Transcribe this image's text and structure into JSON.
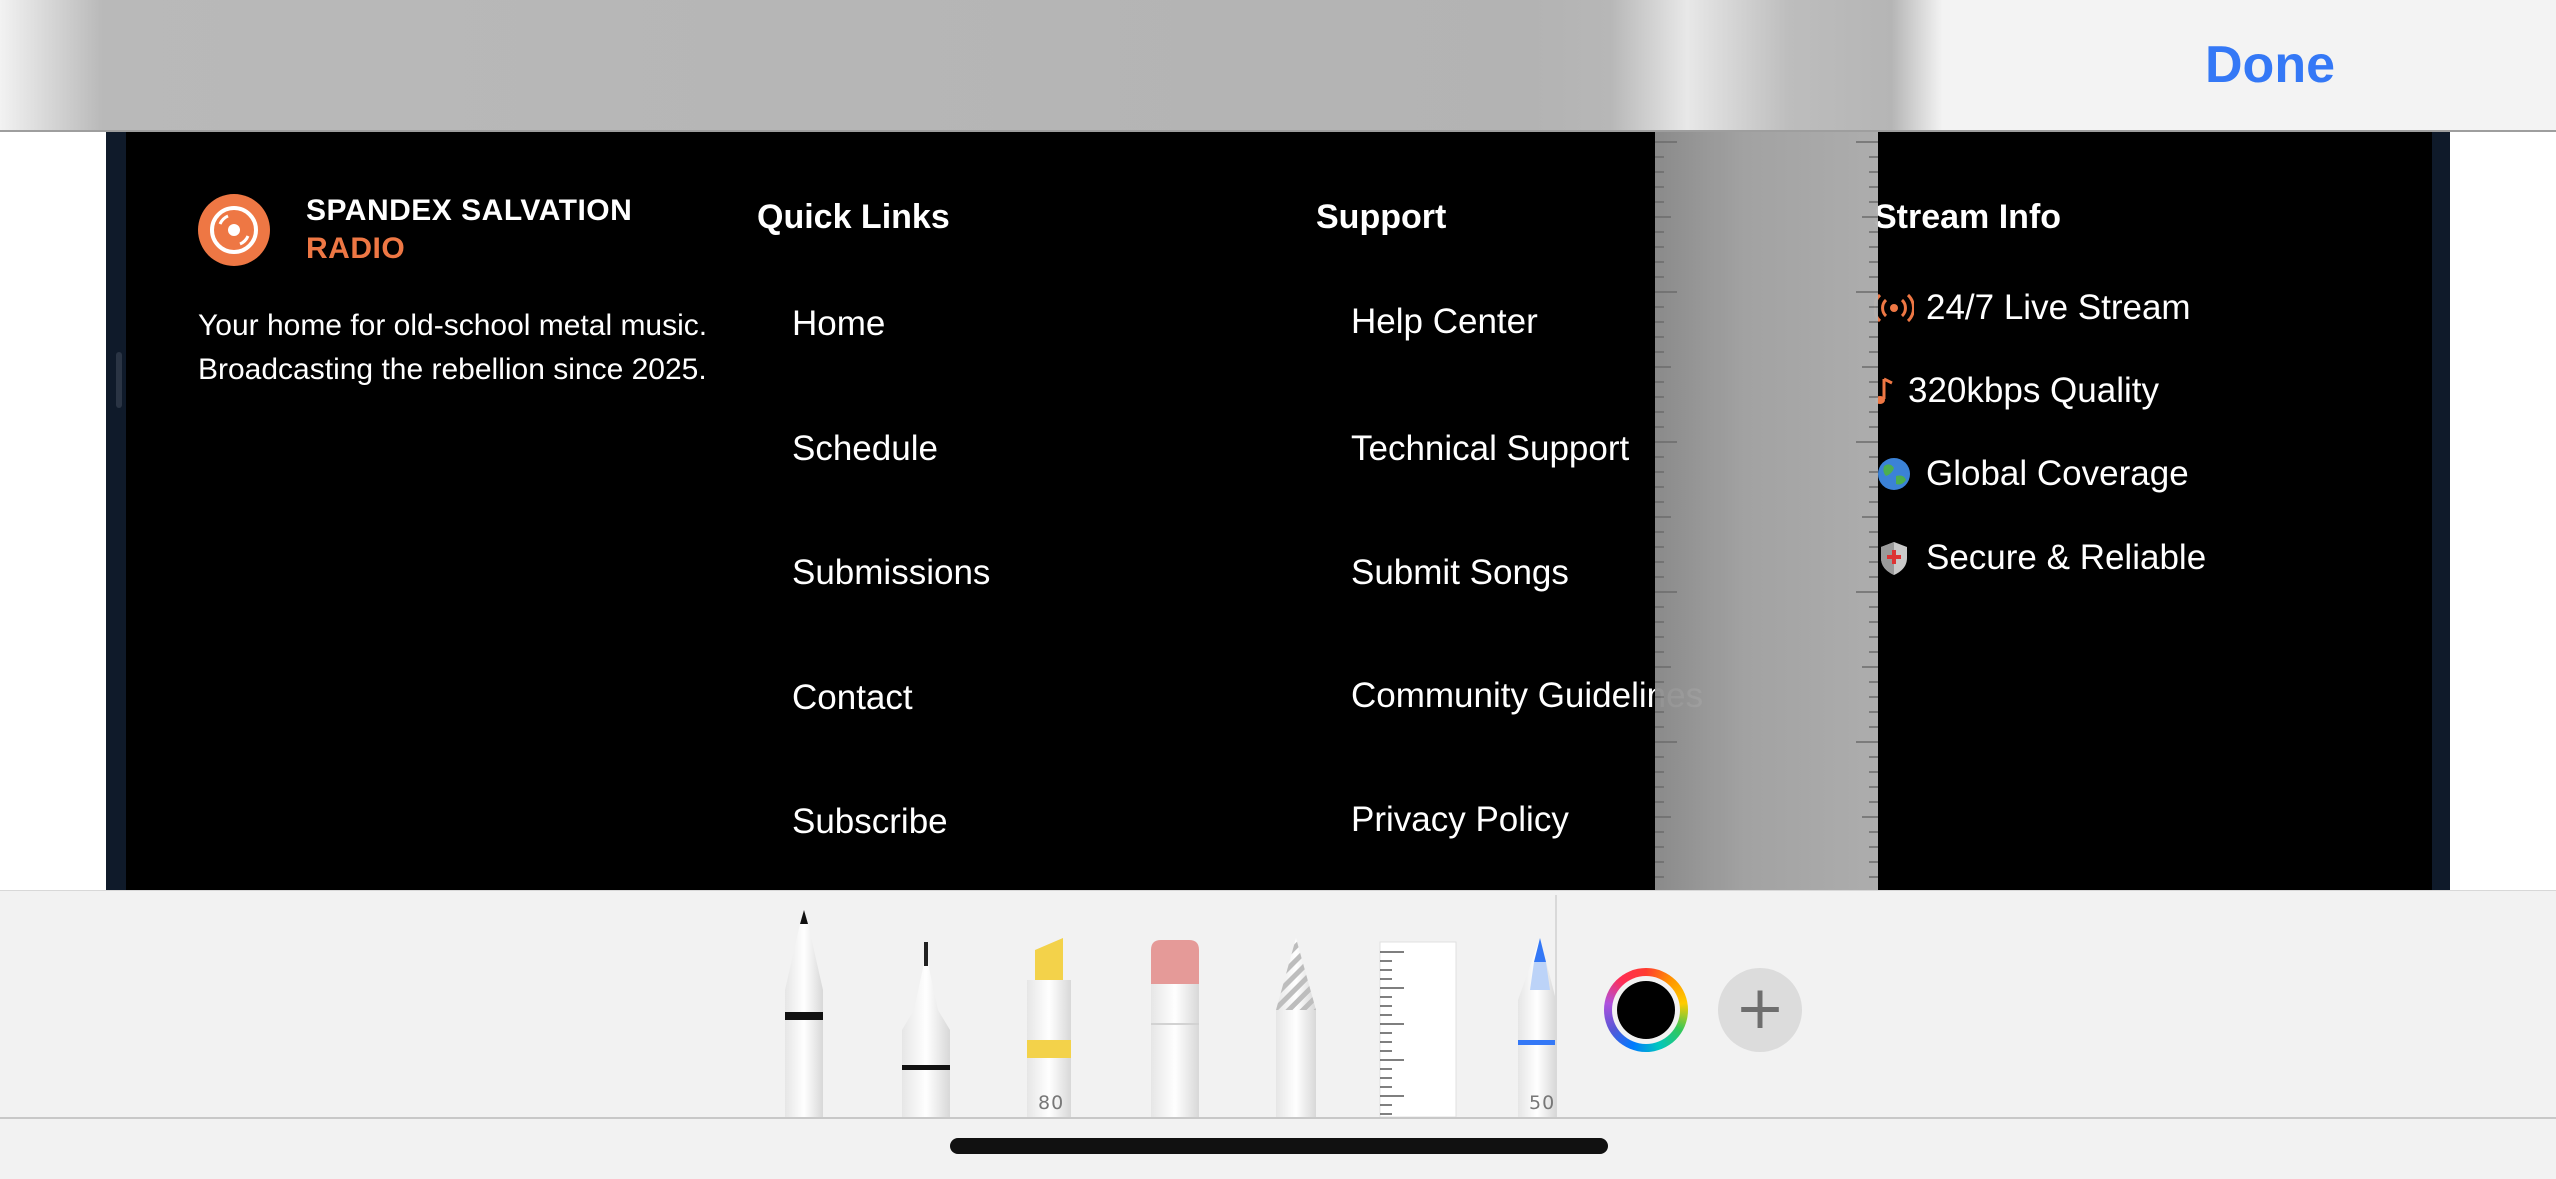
{
  "topbar": {
    "done_label": "Done"
  },
  "footer": {
    "brand": {
      "name_line1": "SPANDEX SALVATION",
      "name_line2": "RADIO",
      "description": "Your home for old-school metal music. Broadcasting the rebellion since 2025."
    },
    "quick_links": {
      "title": "Quick Links",
      "items": [
        "Home",
        "Schedule",
        "Submissions",
        "Contact",
        "Subscribe"
      ]
    },
    "support": {
      "title": "Support",
      "items": [
        "Help Center",
        "Technical Support",
        "Submit Songs",
        "Community Guidelines",
        "Privacy Policy"
      ]
    },
    "stream_info": {
      "title": "Stream Info",
      "items": [
        {
          "icon": "broadcast-icon",
          "label": "24/7 Live Stream"
        },
        {
          "icon": "music-note-icon",
          "label": "320kbps Quality"
        },
        {
          "icon": "globe-icon",
          "label": "Global Coverage"
        },
        {
          "icon": "shield-icon",
          "label": "Secure & Reliable"
        }
      ]
    },
    "colors": {
      "accent": "#ee7744",
      "background": "#000000"
    }
  },
  "palette": {
    "tools": [
      "pen-tool",
      "fineliner-tool",
      "highlighter-tool",
      "eraser-tool",
      "lasso-tool",
      "ruler-tool",
      "pencil-tool"
    ],
    "highlighter_opacity": "80",
    "pencil_opacity": "50",
    "selected_color": "#000000"
  }
}
